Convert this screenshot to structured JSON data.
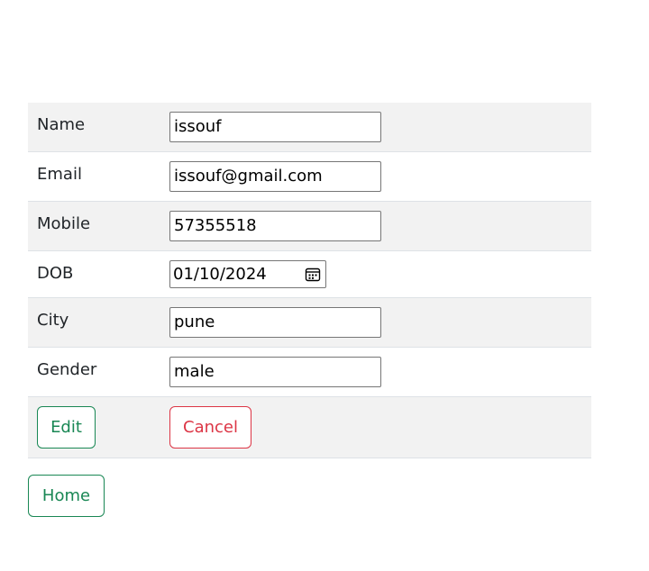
{
  "form": {
    "fields": [
      {
        "label": "Name",
        "value": "issouf"
      },
      {
        "label": "Email",
        "value": "issouf@gmail.com"
      },
      {
        "label": "Mobile",
        "value": "57355518"
      },
      {
        "label": "DOB",
        "value": "01/10/2024"
      },
      {
        "label": "City",
        "value": "pune"
      },
      {
        "label": "Gender",
        "value": "male"
      }
    ],
    "edit_label": "Edit",
    "cancel_label": "Cancel"
  },
  "home_label": "Home",
  "colors": {
    "success": "#198754",
    "danger": "#dc3545",
    "stripe": "#f2f2f2"
  },
  "icons": {
    "date_picker": "calendar-icon"
  }
}
